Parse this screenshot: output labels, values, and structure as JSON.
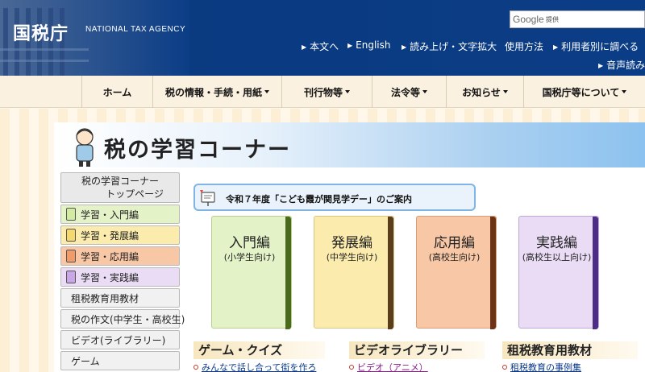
{
  "header": {
    "logo": "国税庁",
    "agency_en": "NATIONAL TAX AGENCY",
    "search_brand": "Google",
    "search_suffix": "提供",
    "util_links": [
      "本文へ",
      "English",
      "読み上げ・文字拡大",
      "使用方法",
      "利用者別に調べる"
    ],
    "voice": "音声読み"
  },
  "nav": {
    "items": [
      "ホーム",
      "税の情報・手続・用紙",
      "刊行物等",
      "法令等",
      "お知らせ",
      "国税庁等について"
    ]
  },
  "banner": {
    "title": "税の学習コーナー"
  },
  "sidebar": {
    "top_line1": "税の学習コーナー",
    "top_line2": "トップページ",
    "items": [
      "学習・入門編",
      "学習・発展編",
      "学習・応用編",
      "学習・実践編",
      "租税教育用教材",
      "税の作文(中学生・高校生)",
      "ビデオ(ライブラリー)",
      "ゲーム"
    ]
  },
  "announcement": {
    "text": "令和７年度「こども霞が関見学デー」のご案内"
  },
  "notebooks": [
    {
      "title": "入門編",
      "sub": "(小学生向け)",
      "color": "#e4f2c8",
      "spine": "#4a6b1e"
    },
    {
      "title": "発展編",
      "sub": "(中学生向け)",
      "color": "#fbecae",
      "spine": "#5a3d1a"
    },
    {
      "title": "応用編",
      "sub": "(高校生向け)",
      "color": "#f8c7a6",
      "spine": "#6b3318"
    },
    {
      "title": "実践編",
      "sub": "(高校生以上向け)",
      "color": "#eadcf5",
      "spine": "#4d2d86"
    }
  ],
  "sections": [
    {
      "title": "ゲーム・クイズ",
      "link": "みんなで話し合って街を作ろ"
    },
    {
      "title": "ビデオライブラリー",
      "link": "ビデオ（アニメ）"
    },
    {
      "title": "租税教育用教材",
      "link": "租税教育の事例集"
    }
  ],
  "colors": {
    "header_bg": "#0b3d86",
    "nav_bg": "#fbf1e0",
    "link_blue": "#0b3a8a",
    "link_purple": "#8a1c8a"
  }
}
